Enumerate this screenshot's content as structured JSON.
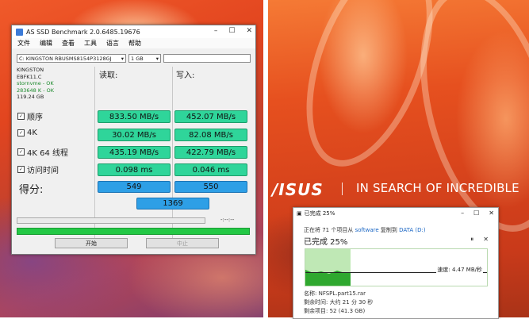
{
  "benchmark": {
    "title": "AS SSD Benchmark 2.0.6485.19676",
    "menu": [
      "文件",
      "编辑",
      "查看",
      "工具",
      "语言",
      "帮助"
    ],
    "drive_select": "C: KINGSTON RBUSMS8154P3128GJ",
    "size_select": "1 GB",
    "info": {
      "model": "KINGSTON",
      "firmware": "EBFK11.C",
      "driver_status": "stornvme - OK",
      "align_status": "283648 K - OK",
      "capacity": "119.24 GB"
    },
    "read_header": "读取:",
    "write_header": "写入:",
    "rows": [
      {
        "label": "顺序",
        "read": "833.50 MB/s",
        "write": "452.07 MB/s"
      },
      {
        "label": "4K",
        "read": "30.02 MB/s",
        "write": "82.08 MB/s"
      },
      {
        "label": "4K 64 线程",
        "read": "435.19 MB/s",
        "write": "422.79 MB/s"
      },
      {
        "label": "访问时间",
        "read": "0.098 ms",
        "write": "0.046 ms"
      }
    ],
    "score_label": "得分:",
    "score_read": "549",
    "score_write": "550",
    "score_total": "1369",
    "progress_text": "-:--:--",
    "progress_fraction": 1.0,
    "start_button": "开始",
    "abort_button": "中止"
  },
  "brand": {
    "logo": "/ISUS",
    "tagline": "IN SEARCH OF INCREDIBLE"
  },
  "copy_dialog": {
    "title": "已完成 25%",
    "path_prefix": "正在将 71 个项目从",
    "path_source": "software",
    "path_mid": "复制到",
    "path_dest": "DATA (D:)",
    "percent_text": "已完成 25%",
    "progress_fraction": 0.25,
    "speed": "速度: 4.47 MB/秒",
    "name_line": "名称: NFSPL.part15.rar",
    "time_line": "剩余时间: 大约 21 分 30 秒",
    "items_line": "剩余项目: 52 (41.3 GB)"
  }
}
